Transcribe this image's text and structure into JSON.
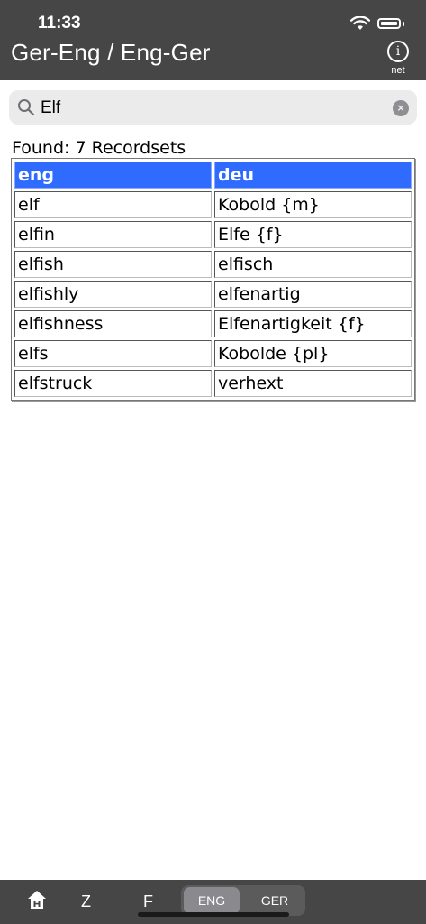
{
  "status": {
    "time": "11:33"
  },
  "header": {
    "title": "Ger-Eng / Eng-Ger",
    "info_label": "net",
    "info_glyph": "i"
  },
  "search": {
    "value": "Elf",
    "clear_glyph": "×"
  },
  "results": {
    "found_text": "Found: 7 Recordsets",
    "columns": [
      "eng",
      "deu"
    ],
    "rows": [
      [
        "elf",
        "Kobold {m}"
      ],
      [
        "elfin",
        "Elfe {f}"
      ],
      [
        "elfish",
        "elfisch"
      ],
      [
        "elfishly",
        "elfenartig"
      ],
      [
        "elfishness",
        "Elfenartigkeit {f}"
      ],
      [
        "elfs",
        "Kobolde {pl}"
      ],
      [
        "elfstruck",
        "verhext"
      ]
    ]
  },
  "bottom": {
    "home_icon": "home-icon",
    "nav": [
      "Z",
      "F"
    ],
    "segments": [
      "ENG",
      "GER"
    ],
    "active_segment": "ENG"
  },
  "colors": {
    "bar": "#464646",
    "header_cell": "#2f6bff",
    "search_bg": "#ebebeb"
  }
}
